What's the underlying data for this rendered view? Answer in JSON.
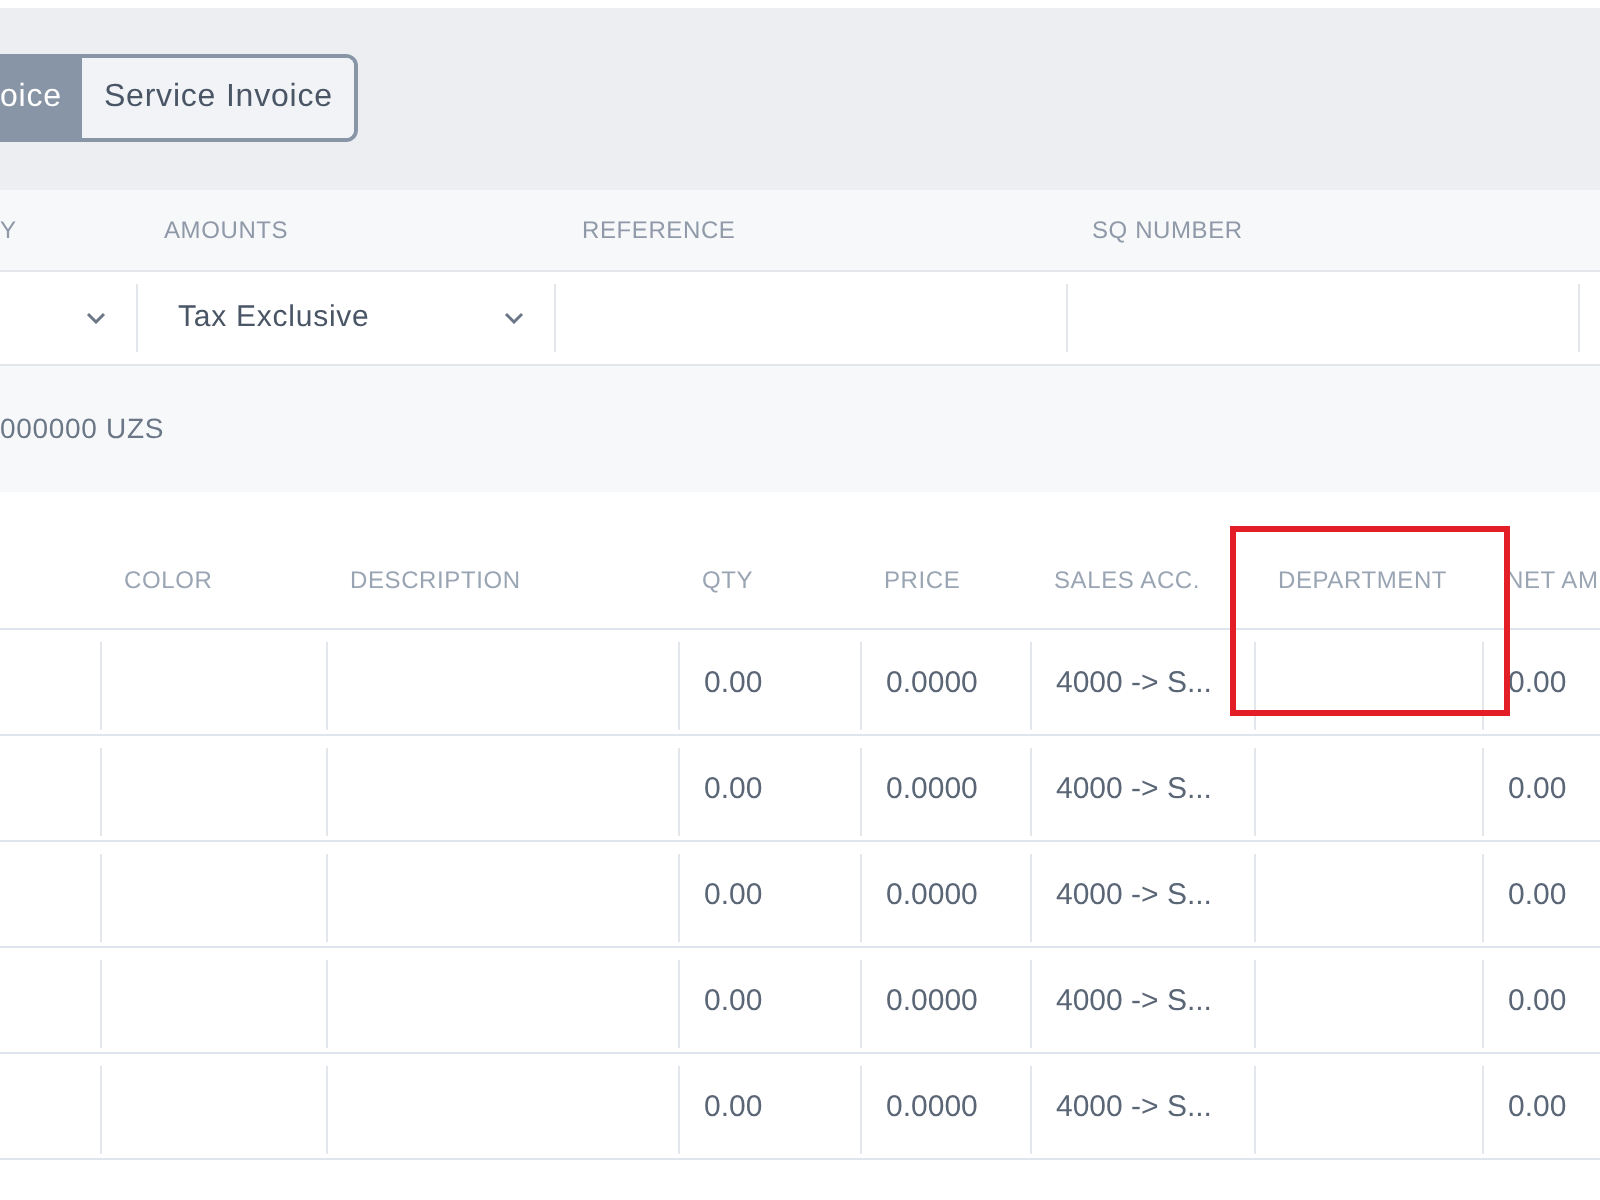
{
  "invoice_type_tabs": [
    {
      "label": "oice",
      "selected": true
    },
    {
      "label": "Service Invoice",
      "selected": false
    }
  ],
  "fields": {
    "labels": [
      "Y",
      "AMOUNTS",
      "REFERENCE",
      "SQ NUMBER"
    ],
    "amounts": {
      "value": "Tax Exclusive"
    }
  },
  "total_line": "000000 UZS",
  "table": {
    "columns": [
      "COLOR",
      "DESCRIPTION",
      "QTY",
      "PRICE",
      "SALES ACC.",
      "DEPARTMENT",
      "NET AM"
    ],
    "rows": [
      {
        "qty": "0.00",
        "price": "0.0000",
        "sales_acc": "4000 -> S...",
        "net_amount": "0.00"
      },
      {
        "qty": "0.00",
        "price": "0.0000",
        "sales_acc": "4000 -> S...",
        "net_amount": "0.00"
      },
      {
        "qty": "0.00",
        "price": "0.0000",
        "sales_acc": "4000 -> S...",
        "net_amount": "0.00"
      },
      {
        "qty": "0.00",
        "price": "0.0000",
        "sales_acc": "4000 -> S...",
        "net_amount": "0.00"
      },
      {
        "qty": "0.00",
        "price": "0.0000",
        "sales_acc": "4000 -> S...",
        "net_amount": "0.00"
      }
    ]
  }
}
